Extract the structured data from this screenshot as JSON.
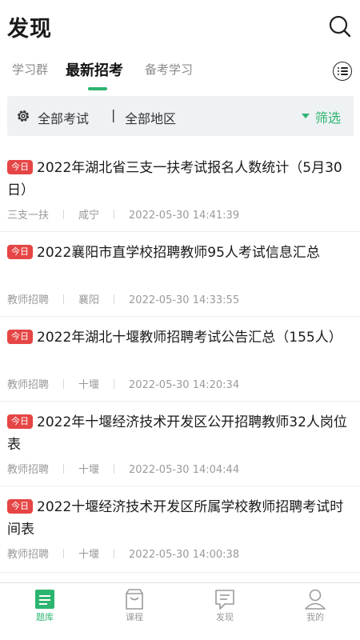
{
  "header": {
    "title": "发现"
  },
  "tabs": [
    {
      "label": "学习群",
      "active": false
    },
    {
      "label": "最新招考",
      "active": true
    },
    {
      "label": "备考学习",
      "active": false
    }
  ],
  "filter": {
    "exam": "全部考试",
    "separator": "|",
    "region": "全部地区",
    "label": "筛选"
  },
  "articles": [
    {
      "badge": "今日",
      "title": "2022年湖北省三支一扶考试报名人数统计（5月30日）",
      "category": "三支一扶",
      "region": "咸宁",
      "time": "2022-05-30 14:41:39"
    },
    {
      "badge": "今日",
      "title": "2022襄阳市直学校招聘教师95人考试信息汇总",
      "category": "教师招聘",
      "region": "襄阳",
      "time": "2022-05-30 14:33:55"
    },
    {
      "badge": "今日",
      "title": "2022年湖北十堰教师招聘考试公告汇总（155人）",
      "category": "教师招聘",
      "region": "十堰",
      "time": "2022-05-30 14:20:34"
    },
    {
      "badge": "今日",
      "title": "2022年十堰经济技术开发区公开招聘教师32人岗位表",
      "category": "教师招聘",
      "region": "十堰",
      "time": "2022-05-30 14:04:44"
    },
    {
      "badge": "今日",
      "title": "2022十堰经济技术开发区所属学校教师招聘考试时间表",
      "category": "教师招聘",
      "region": "十堰",
      "time": "2022-05-30 14:00:38"
    }
  ],
  "bottom_nav": [
    {
      "label": "题库",
      "icon": "question-bank-icon",
      "active": true
    },
    {
      "label": "课程",
      "icon": "course-bag-icon",
      "active": false
    },
    {
      "label": "发现",
      "icon": "discover-chat-icon",
      "active": false
    },
    {
      "label": "我的",
      "icon": "profile-person-icon",
      "active": false
    }
  ],
  "colors": {
    "accent": "#2cb56f",
    "badge": "#e64545",
    "filter_bg": "#eef2f5"
  }
}
